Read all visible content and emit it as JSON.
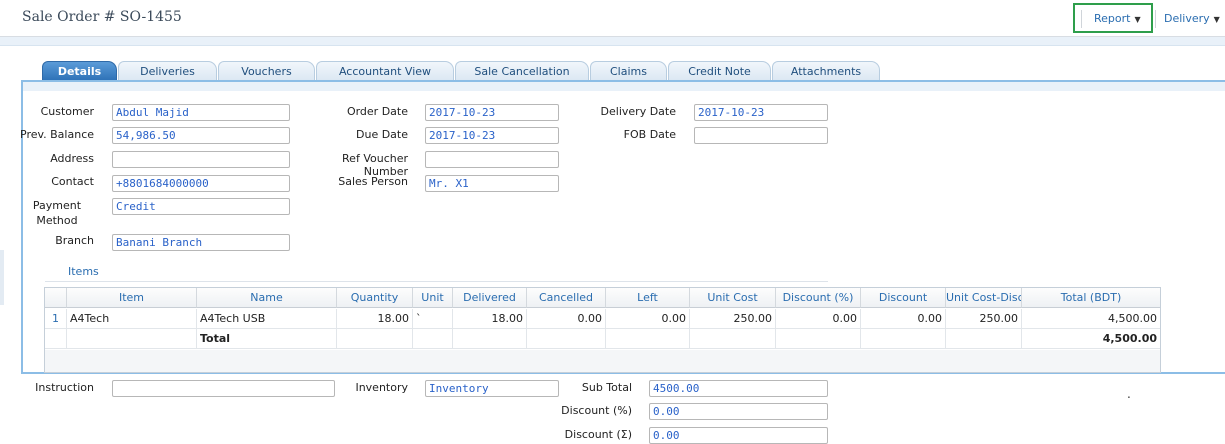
{
  "header": {
    "title": "Sale Order # SO-1455",
    "report_label": "Report",
    "delivery_label": "Delivery",
    "highlight_color": "#2e9e4b"
  },
  "tabs": [
    {
      "label": "Details",
      "active": true
    },
    {
      "label": "Deliveries"
    },
    {
      "label": "Vouchers"
    },
    {
      "label": "Accountant View"
    },
    {
      "label": "Sale Cancellation"
    },
    {
      "label": "Claims"
    },
    {
      "label": "Credit Note"
    },
    {
      "label": "Attachments"
    }
  ],
  "form": {
    "customer_label": "Customer",
    "customer_value": "Abdul Majid",
    "prev_balance_label": "Prev. Balance",
    "prev_balance_value": "54,986.50",
    "address_label": "Address",
    "address_value": "",
    "contact_label": "Contact",
    "contact_value": "+8801684000000",
    "payment_label_1": "Payment",
    "payment_label_2": "Method",
    "payment_value": "Credit",
    "branch_label": "Branch",
    "branch_value": "Banani Branch",
    "order_date_label": "Order Date",
    "order_date_value": "2017-10-23",
    "due_date_label": "Due Date",
    "due_date_value": "2017-10-23",
    "ref_voucher_label": "Ref Voucher Number",
    "ref_voucher_value": "",
    "sales_person_label": "Sales Person",
    "sales_person_value": "Mr. X1",
    "delivery_date_label": "Delivery Date",
    "delivery_date_value": "2017-10-23",
    "fob_date_label": "FOB Date",
    "fob_date_value": ""
  },
  "items": {
    "title": "Items",
    "columns": [
      "Item",
      "Name",
      "Quantity",
      "Unit",
      "Delivered",
      "Cancelled",
      "Left",
      "Unit Cost",
      "Discount (%)",
      "Discount",
      "Unit Cost-Disc",
      "Total (BDT)"
    ],
    "rows": [
      {
        "index": "1",
        "item": "A4Tech",
        "name": "A4Tech USB",
        "quantity": "18.00",
        "unit": "`",
        "delivered": "18.00",
        "cancelled": "0.00",
        "left": "0.00",
        "unit_cost": "250.00",
        "discount_pct": "0.00",
        "discount": "0.00",
        "unit_cost_disc": "250.00",
        "total": "4,500.00"
      }
    ],
    "total_label": "Total",
    "total_value": "4,500.00"
  },
  "footer": {
    "instruction_label": "Instruction",
    "instruction_value": "",
    "inventory_label": "Inventory",
    "inventory_value": "Inventory",
    "sub_total_label": "Sub Total",
    "sub_total_value": "4500.00",
    "discount_pct_label": "Discount (%)",
    "discount_pct_value": "0.00",
    "discount_sum_label": "Discount (Σ)",
    "discount_sum_value": "0.00",
    "dot": "."
  }
}
